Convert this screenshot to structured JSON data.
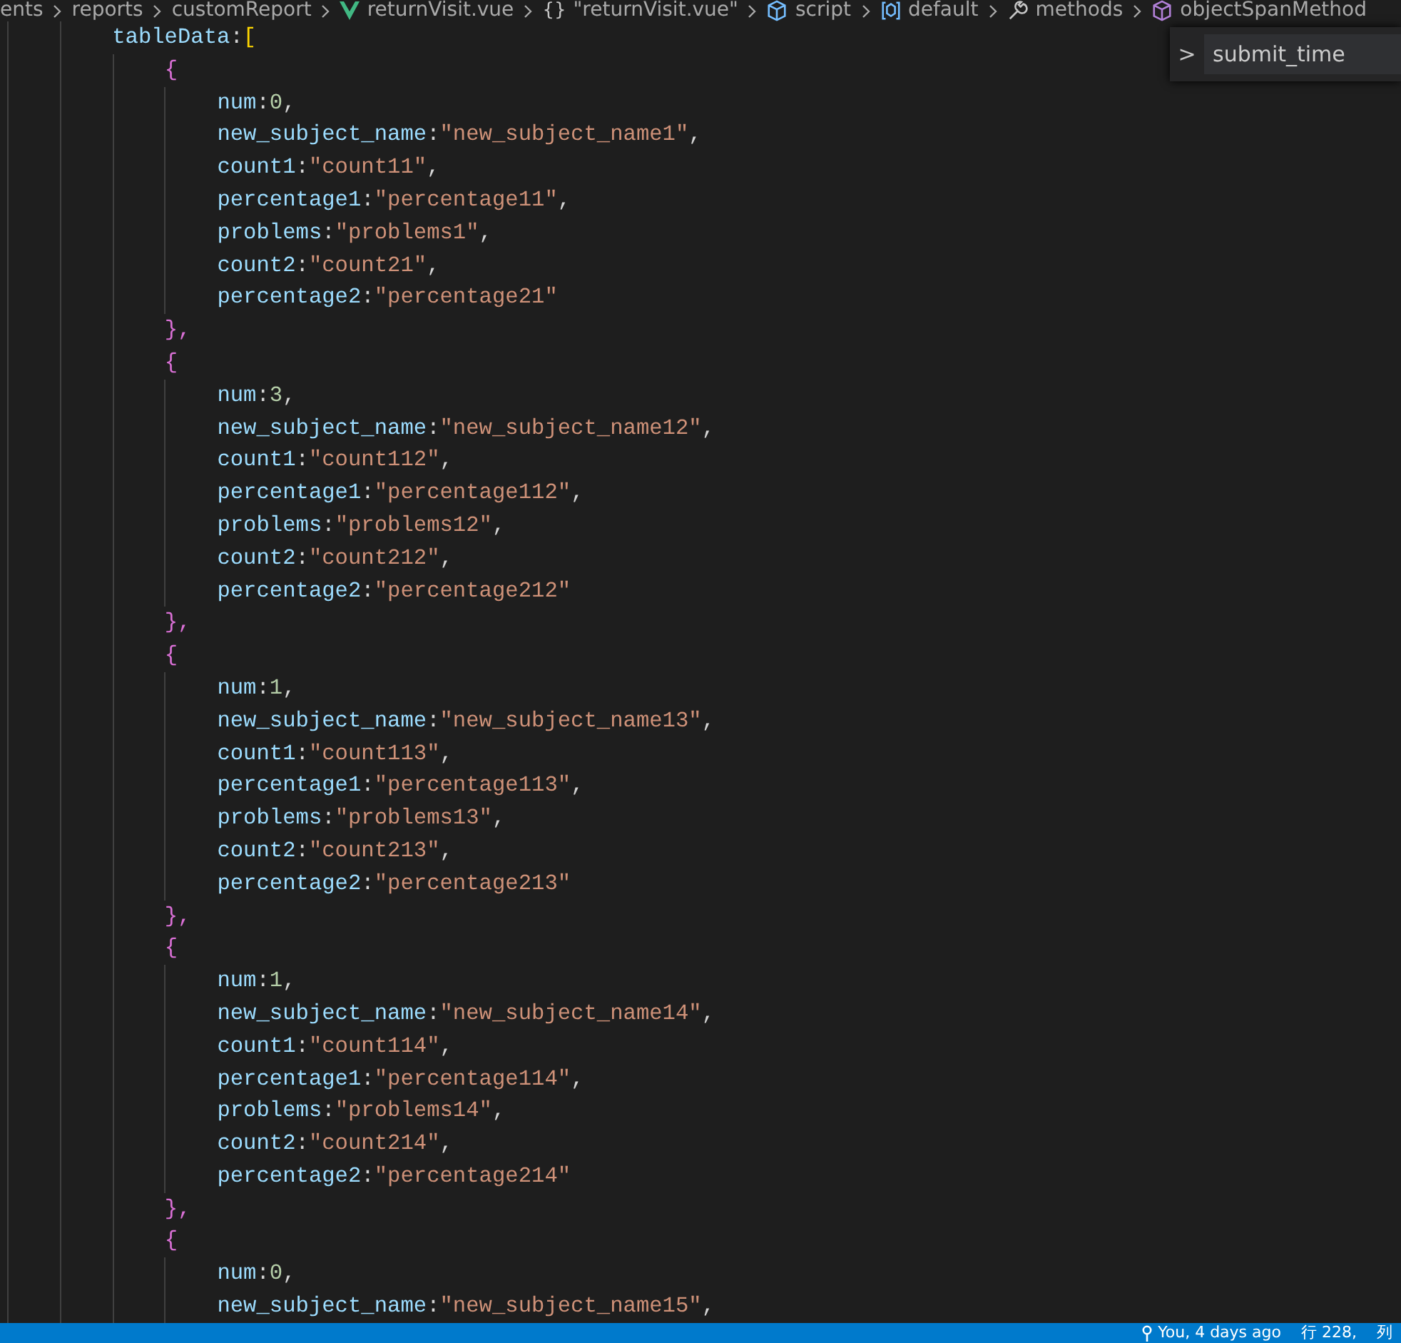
{
  "breadcrumb": [
    {
      "label": "ents",
      "kind": "folder"
    },
    {
      "label": "reports",
      "kind": "folder"
    },
    {
      "label": "customReport",
      "kind": "folder"
    },
    {
      "label": "returnVisit.vue",
      "kind": "vue"
    },
    {
      "label": "\"returnVisit.vue\"",
      "kind": "object",
      "glyph": "{}"
    },
    {
      "label": "script",
      "kind": "cube"
    },
    {
      "label": "default",
      "kind": "module"
    },
    {
      "label": "methods",
      "kind": "wrench"
    },
    {
      "label": "objectSpanMethod",
      "kind": "method"
    }
  ],
  "sticky_widget": {
    "chevron": ">",
    "label": "submit_time"
  },
  "code": {
    "name": "tableData",
    "colon": ":",
    "open": "[",
    "items": [
      {
        "open": "{",
        "close": "},",
        "fields": [
          {
            "key": "num",
            "value": "0",
            "kind": "number",
            "trail": ","
          },
          {
            "key": "new_subject_name",
            "value": "\"new_subject_name1\"",
            "kind": "string",
            "trail": ","
          },
          {
            "key": "count1",
            "value": "\"count11\"",
            "kind": "string",
            "trail": ","
          },
          {
            "key": "percentage1",
            "value": "\"percentage11\"",
            "kind": "string",
            "trail": ","
          },
          {
            "key": "problems",
            "value": "\"problems1\"",
            "kind": "string",
            "trail": ","
          },
          {
            "key": "count2",
            "value": "\"count21\"",
            "kind": "string",
            "trail": ","
          },
          {
            "key": "percentage2",
            "value": "\"percentage21\"",
            "kind": "string"
          }
        ]
      },
      {
        "open": "{",
        "close": "},",
        "fields": [
          {
            "key": "num",
            "value": "3",
            "kind": "number",
            "trail": ","
          },
          {
            "key": "new_subject_name",
            "value": "\"new_subject_name12\"",
            "kind": "string",
            "trail": ","
          },
          {
            "key": "count1",
            "value": "\"count112\"",
            "kind": "string",
            "trail": ","
          },
          {
            "key": "percentage1",
            "value": "\"percentage112\"",
            "kind": "string",
            "trail": ","
          },
          {
            "key": "problems",
            "value": "\"problems12\"",
            "kind": "string",
            "trail": ","
          },
          {
            "key": "count2",
            "value": "\"count212\"",
            "kind": "string",
            "trail": ","
          },
          {
            "key": "percentage2",
            "value": "\"percentage212\"",
            "kind": "string"
          }
        ]
      },
      {
        "open": "{",
        "close": "},",
        "fields": [
          {
            "key": "num",
            "value": "1",
            "kind": "number",
            "trail": ","
          },
          {
            "key": "new_subject_name",
            "value": "\"new_subject_name13\"",
            "kind": "string",
            "trail": ","
          },
          {
            "key": "count1",
            "value": "\"count113\"",
            "kind": "string",
            "trail": ","
          },
          {
            "key": "percentage1",
            "value": "\"percentage113\"",
            "kind": "string",
            "trail": ","
          },
          {
            "key": "problems",
            "value": "\"problems13\"",
            "kind": "string",
            "trail": ","
          },
          {
            "key": "count2",
            "value": "\"count213\"",
            "kind": "string",
            "trail": ","
          },
          {
            "key": "percentage2",
            "value": "\"percentage213\"",
            "kind": "string"
          }
        ]
      },
      {
        "open": "{",
        "close": "},",
        "fields": [
          {
            "key": "num",
            "value": "1",
            "kind": "number",
            "trail": ","
          },
          {
            "key": "new_subject_name",
            "value": "\"new_subject_name14\"",
            "kind": "string",
            "trail": ","
          },
          {
            "key": "count1",
            "value": "\"count114\"",
            "kind": "string",
            "trail": ","
          },
          {
            "key": "percentage1",
            "value": "\"percentage114\"",
            "kind": "string",
            "trail": ","
          },
          {
            "key": "problems",
            "value": "\"problems14\"",
            "kind": "string",
            "trail": ","
          },
          {
            "key": "count2",
            "value": "\"count214\"",
            "kind": "string",
            "trail": ","
          },
          {
            "key": "percentage2",
            "value": "\"percentage214\"",
            "kind": "string"
          }
        ]
      },
      {
        "open": "{",
        "fields": [
          {
            "key": "num",
            "value": "0",
            "kind": "number",
            "trail": ","
          },
          {
            "key": "new_subject_name",
            "value": "\"new_subject_name15\"",
            "kind": "string",
            "trail": ","
          }
        ]
      }
    ]
  },
  "status_bar": {
    "blame": "You, 4 days ago",
    "position": "行 228,",
    "column": "列"
  }
}
